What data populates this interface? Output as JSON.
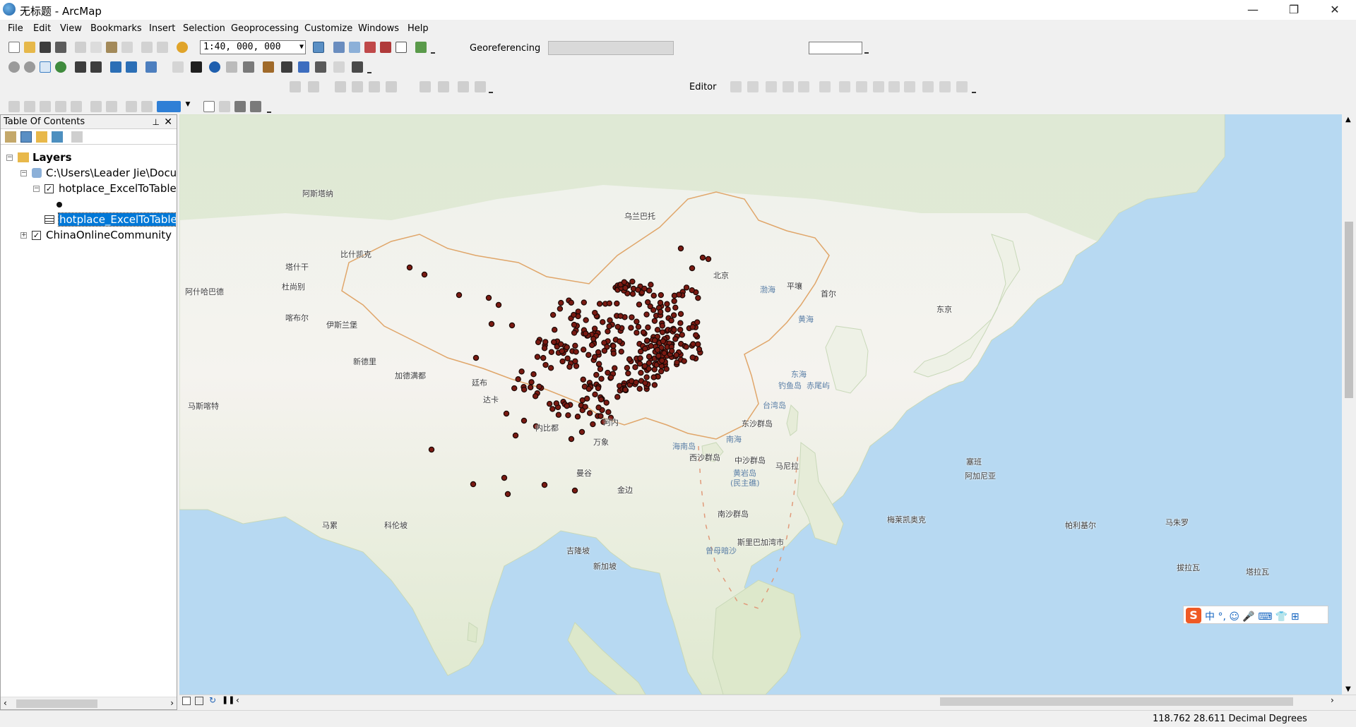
{
  "window": {
    "title": "无标题 - ArcMap",
    "controls": [
      "—",
      "❐",
      "✕"
    ]
  },
  "menubar": [
    "File",
    "Edit",
    "View",
    "Bookmarks",
    "Insert",
    "Selection",
    "Geoprocessing",
    "Customize",
    "Windows",
    "Help"
  ],
  "toolbar": {
    "scale": "1:40, 000, 000",
    "georeferencing_label": "Georeferencing",
    "editor_label": "Editor"
  },
  "toc": {
    "title": "Table Of Contents",
    "root": "Layers",
    "folder": "C:\\Users\\Leader Jie\\Docu",
    "layer1": "hotplace_ExcelToTable",
    "table1": "hotplace_ExcelToTable",
    "layer2": "ChinaOnlineCommunity"
  },
  "map": {
    "places": [
      {
        "name": "阿斯塔纳",
        "sea": false
      },
      {
        "name": "乌兰巴托",
        "sea": false
      },
      {
        "name": "比什凯克",
        "sea": false
      },
      {
        "name": "塔什干",
        "sea": false
      },
      {
        "name": "杜尚别",
        "sea": false
      },
      {
        "name": "阿什哈巴德",
        "sea": false
      },
      {
        "name": "喀布尔",
        "sea": false
      },
      {
        "name": "伊斯兰堡",
        "sea": false
      },
      {
        "name": "新德里",
        "sea": false
      },
      {
        "name": "加德满都",
        "sea": false
      },
      {
        "name": "廷布",
        "sea": false
      },
      {
        "name": "达卡",
        "sea": false
      },
      {
        "name": "马斯喀特",
        "sea": false
      },
      {
        "name": "内比都",
        "sea": false
      },
      {
        "name": "河内",
        "sea": false
      },
      {
        "name": "万象",
        "sea": false
      },
      {
        "name": "曼谷",
        "sea": false
      },
      {
        "name": "金边",
        "sea": false
      },
      {
        "name": "马累",
        "sea": false
      },
      {
        "name": "科伦坡",
        "sea": false
      },
      {
        "name": "吉隆坡",
        "sea": false
      },
      {
        "name": "新加坡",
        "sea": false
      },
      {
        "name": "北京",
        "sea": false
      },
      {
        "name": "平壤",
        "sea": false
      },
      {
        "name": "首尔",
        "sea": false
      },
      {
        "name": "东京",
        "sea": false
      },
      {
        "name": "渤海",
        "sea": true
      },
      {
        "name": "黄海",
        "sea": true
      },
      {
        "name": "东海",
        "sea": true
      },
      {
        "name": "钓鱼岛",
        "sea": true
      },
      {
        "name": "赤尾屿",
        "sea": true
      },
      {
        "name": "台湾岛",
        "sea": true
      },
      {
        "name": "东沙群岛",
        "sea": false
      },
      {
        "name": "南海",
        "sea": true
      },
      {
        "name": "海南岛",
        "sea": true
      },
      {
        "name": "西沙群岛",
        "sea": false
      },
      {
        "name": "中沙群岛",
        "sea": false
      },
      {
        "name": "黄岩岛",
        "sea": true
      },
      {
        "name": "(民主礁)",
        "sea": true
      },
      {
        "name": "马尼拉",
        "sea": false
      },
      {
        "name": "南沙群岛",
        "sea": false
      },
      {
        "name": "曾母暗沙",
        "sea": true
      },
      {
        "name": "斯里巴加湾市",
        "sea": false
      },
      {
        "name": "塞班",
        "sea": false
      },
      {
        "name": "阿加尼亚",
        "sea": false
      },
      {
        "name": "梅莱凯奥克",
        "sea": false
      },
      {
        "name": "帕利基尔",
        "sea": false
      },
      {
        "name": "马朱罗",
        "sea": false
      },
      {
        "name": "塔拉瓦",
        "sea": false
      },
      {
        "name": "拔拉瓦",
        "sea": false
      }
    ]
  },
  "status": {
    "coordinates": "118.762  28.611 Decimal Degrees"
  },
  "ime": {
    "logo": "S",
    "text": "中 °, ☺ 🎤 ⌨ 👕 ⊞"
  }
}
